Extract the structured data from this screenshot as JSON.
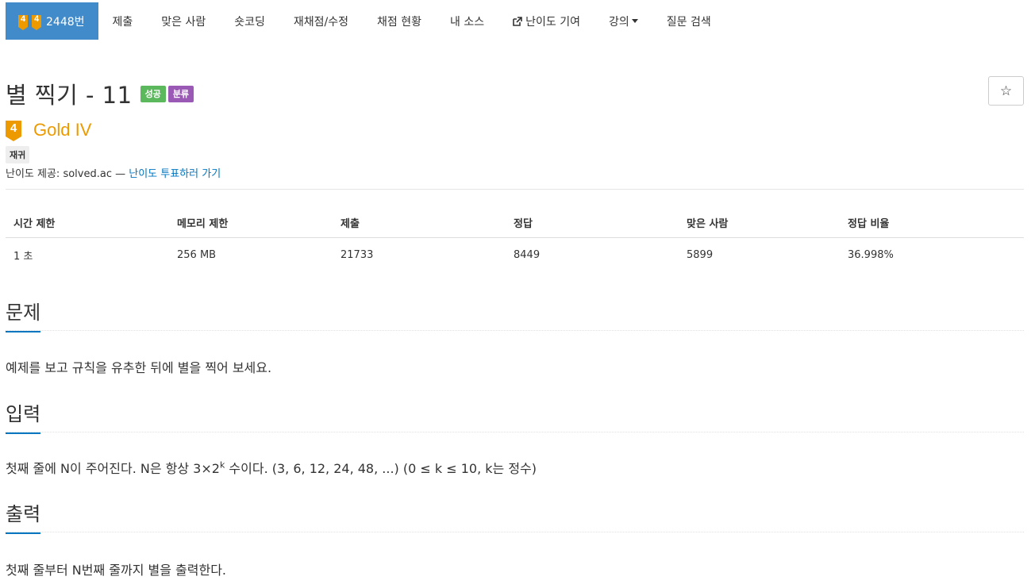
{
  "nav": {
    "problem_number": "2448번",
    "tier_number": "4",
    "items": [
      {
        "label": "제출"
      },
      {
        "label": "맞은 사람"
      },
      {
        "label": "숏코딩"
      },
      {
        "label": "재채점/수정"
      },
      {
        "label": "채점 현황"
      },
      {
        "label": "내 소스"
      },
      {
        "label": "난이도 기여"
      },
      {
        "label": "강의"
      },
      {
        "label": "질문 검색"
      }
    ]
  },
  "problem": {
    "title": "별 찍기 - 11",
    "labels": {
      "success": "성공",
      "category": "분류"
    },
    "star_symbol": "☆",
    "tier_number": "4",
    "tier_name": "Gold IV",
    "tier_color": "#ec9a00",
    "tag": "재귀",
    "provider_prefix": "난이도 제공: solved.ac — ",
    "provider_link": "난이도 투표하러 가기"
  },
  "stats": {
    "headers": [
      "시간 제한",
      "메모리 제한",
      "제출",
      "정답",
      "맞은 사람",
      "정답 비율"
    ],
    "values": [
      "1 초",
      "256 MB",
      "21733",
      "8449",
      "5899",
      "36.998%"
    ]
  },
  "sections": {
    "problem": {
      "title": "문제",
      "text": "예제를 보고 규칙을 유추한 뒤에 별을 찍어 보세요."
    },
    "input": {
      "title": "입력",
      "text_before": "첫째 줄에 N이 주어진다. N은 항상 3×2",
      "sup": "k",
      "text_after": " 수이다. (3, 6, 12, 24, 48, ...) (0 ≤ k ≤ 10, k는 정수)"
    },
    "output": {
      "title": "출력",
      "text": "첫째 줄부터 N번째 줄까지 별을 출력한다."
    }
  },
  "colors": {
    "nav_active": "#428bca",
    "link": "#0076c0",
    "success": "#5cb85c",
    "category": "#9b59b6"
  }
}
